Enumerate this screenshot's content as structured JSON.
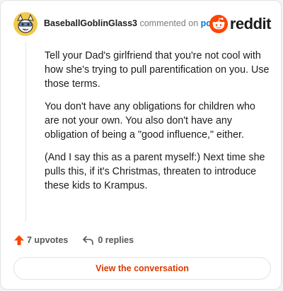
{
  "comment": {
    "username": "BaseballGoblinGlass3",
    "action_text": "commented on",
    "post_link": "post",
    "paragraphs": [
      "Tell your Dad's girlfriend that you're not cool with how she's trying to pull parentification on you. Use those terms.",
      "You don't have any obligations for children who are not your own. You also don't have any obligation of being a \"good influence,\" either.",
      "(And I say this as a parent myself:) Next time she pulls this, if it's Christmas, threaten to introduce these kids to Krampus."
    ]
  },
  "brand": {
    "wordmark": "reddit",
    "icon": "reddit-snoo-icon",
    "color": "#ff4500"
  },
  "actions": {
    "upvotes_label": "7 upvotes",
    "upvote_icon": "upvote-arrow-icon",
    "replies_label": "0 replies",
    "reply_icon": "reply-arrow-icon"
  },
  "view_button": {
    "label": "View the conversation",
    "color": "#d93a00"
  },
  "colors": {
    "link": "#0079d3",
    "upvote": "#ff4500",
    "avatar_bg": "#f2c94c"
  }
}
